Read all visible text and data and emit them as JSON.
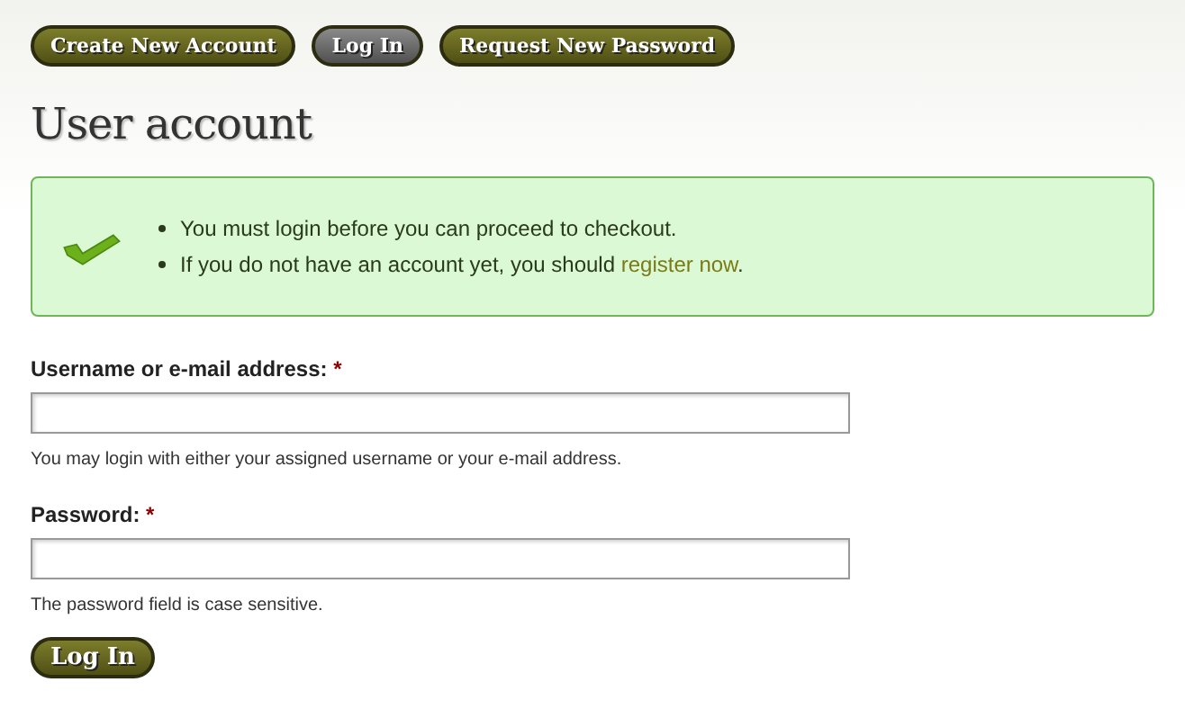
{
  "tabs": [
    {
      "label": "Create New Account",
      "selected": false
    },
    {
      "label": "Log In",
      "selected": true
    },
    {
      "label": "Request New Password",
      "selected": false
    }
  ],
  "title": "User account",
  "message": {
    "items": [
      [
        {
          "kind": "text",
          "text": "You must login before you can proceed to checkout."
        }
      ],
      [
        {
          "kind": "text",
          "text": "If you do not have an account yet, you should "
        },
        {
          "kind": "link",
          "text": "register now"
        },
        {
          "kind": "text",
          "text": "."
        }
      ]
    ]
  },
  "fields": [
    {
      "label": "Username or e-mail address:",
      "required_mark": "*",
      "description": "You may login with either your assigned username or your e-mail address."
    },
    {
      "label": "Password:",
      "required_mark": "*",
      "description": "The password field is case sensitive."
    }
  ],
  "submit": "Log In"
}
